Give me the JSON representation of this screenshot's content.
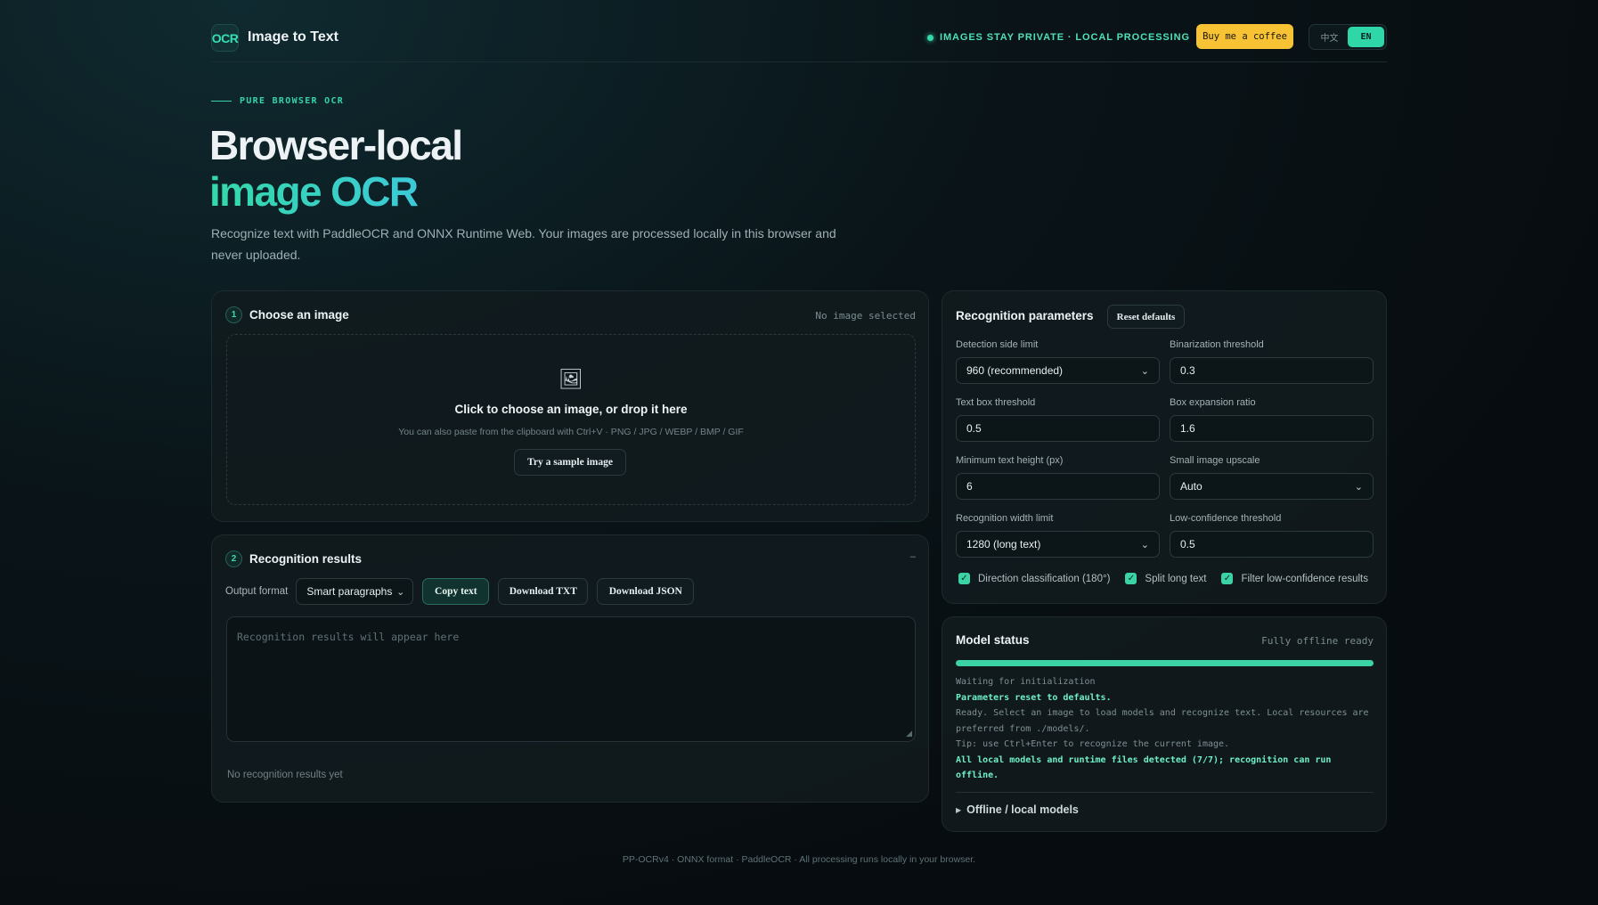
{
  "header": {
    "logo_text": "OCR",
    "app_title": "Image to Text",
    "privacy_text": "IMAGES STAY PRIVATE · LOCAL PROCESSING",
    "coffee_label": "Buy me a coffee",
    "lang_zh": "中文",
    "lang_en": "EN",
    "active_lang": "EN"
  },
  "hero": {
    "eyebrow": "PURE BROWSER OCR",
    "title_line1": "Browser-local",
    "title_line2": "image OCR",
    "description": "Recognize text with PaddleOCR and ONNX Runtime Web. Your images are processed locally in this browser and never uploaded."
  },
  "choose": {
    "step": "1",
    "title": "Choose an image",
    "status": "No image selected",
    "icon": "image-icon",
    "drop_title": "Click to choose an image, or drop it here",
    "drop_sub": "You can also paste from the clipboard with Ctrl+V · PNG / JPG / WEBP / BMP / GIF",
    "sample_label": "Try a sample image"
  },
  "results": {
    "step": "2",
    "title": "Recognition results",
    "collapse": "–",
    "output_label": "Output format",
    "output_value": "Smart paragraphs",
    "copy_label": "Copy text",
    "txt_label": "Download TXT",
    "json_label": "Download JSON",
    "placeholder": "Recognition results will appear here",
    "empty_note": "No recognition results yet"
  },
  "params": {
    "title": "Recognition parameters",
    "reset_label": "Reset defaults",
    "fields": [
      {
        "label": "Detection side limit",
        "value": "960 (recommended)",
        "type": "select"
      },
      {
        "label": "Binarization threshold",
        "value": "0.3",
        "type": "input"
      },
      {
        "label": "Text box threshold",
        "value": "0.5",
        "type": "input"
      },
      {
        "label": "Box expansion ratio",
        "value": "1.6",
        "type": "input"
      },
      {
        "label": "Minimum text height (px)",
        "value": "6",
        "type": "input"
      },
      {
        "label": "Small image upscale",
        "value": "Auto",
        "type": "select"
      },
      {
        "label": "Recognition width limit",
        "value": "1280 (long text)",
        "type": "select"
      },
      {
        "label": "Low-confidence threshold",
        "value": "0.5",
        "type": "input"
      }
    ],
    "checks": [
      {
        "label": "Direction classification (180°)",
        "checked": true
      },
      {
        "label": "Split long text",
        "checked": true
      },
      {
        "label": "Filter low-confidence results",
        "checked": true
      }
    ]
  },
  "model": {
    "title": "Model status",
    "status": "Fully offline ready",
    "progress": 1.0,
    "log": [
      {
        "text": "Waiting for initialization",
        "highlight": false
      },
      {
        "text": "Parameters reset to defaults.",
        "highlight": true
      },
      {
        "text": "Ready. Select an image to load models and recognize text. Local resources are preferred from ./models/.",
        "highlight": false
      },
      {
        "text": "Tip: use Ctrl+Enter to recognize the current image.",
        "highlight": false
      },
      {
        "text": "All local models and runtime files detected (7/7); recognition can run offline.",
        "highlight": true
      }
    ],
    "offline_label": "Offline / local models"
  },
  "footer": "PP-OCRv4 · ONNX format · PaddleOCR · All processing runs locally in your browser.",
  "colors": {
    "accent": "#3bd3a4",
    "coffee": "#f7c234",
    "background": "#070c10"
  }
}
